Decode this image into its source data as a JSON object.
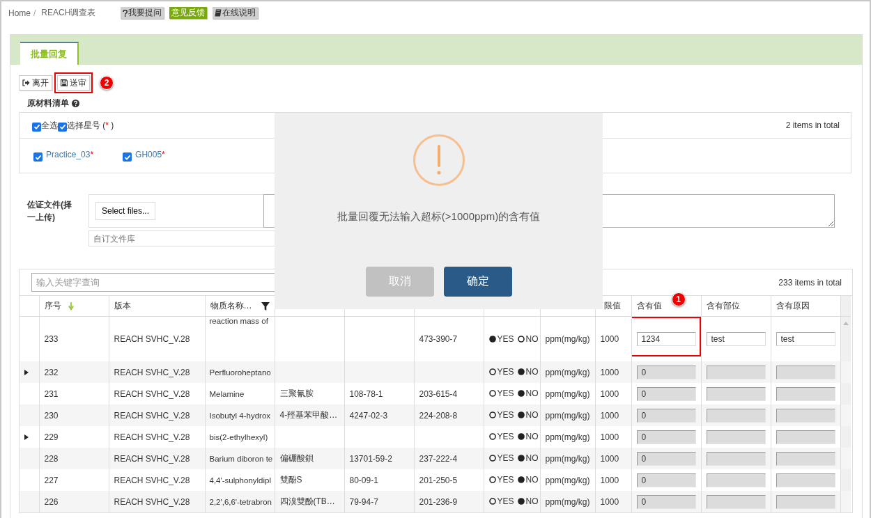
{
  "breadcrumb": [
    "Home",
    "REACH调查表"
  ],
  "breadcrumb_separator": "/",
  "header_buttons": [
    {
      "kind": "ask",
      "label": "我要提问"
    },
    {
      "kind": "feedback",
      "label": "意见反馈"
    },
    {
      "kind": "manual",
      "label": "在线说明"
    }
  ],
  "tabs": [
    {
      "label": "批量回复",
      "selected": true
    }
  ],
  "toolbar": [
    {
      "kind": "exit",
      "label": "离开",
      "highlighted": false
    },
    {
      "kind": "submit",
      "label": "送审",
      "highlighted": true,
      "badge": "2"
    }
  ],
  "materials_section": {
    "title": "原材料清单",
    "options": [
      {
        "label": "全选",
        "checked": true
      },
      {
        "label": "选择星号 (",
        "mark": "*",
        "suffix": " )",
        "checked": true
      }
    ],
    "total": "2 items in total",
    "items": [
      {
        "label": "Practice_03",
        "mark": "*",
        "checked": true
      },
      {
        "label": "GH005",
        "mark": "*",
        "checked": true
      }
    ]
  },
  "evidence": {
    "label": "佐证文件(择一上传)",
    "select_button": "Select files...",
    "library_placeholder": "自订文件库"
  },
  "grid": {
    "search_placeholder": "输入关键字查询",
    "total": "233 items in total",
    "columns": [
      {
        "label": "序号",
        "sorted_descending": true
      },
      {
        "label": "版本"
      },
      {
        "label": "物质名称…",
        "filter": true
      },
      {},
      {},
      {},
      {},
      {},
      {
        "label": "限值"
      },
      {
        "label": "含有值",
        "badge": "1"
      },
      {
        "label": "含有部位"
      },
      {
        "label": "含有原因"
      }
    ],
    "rows": [
      {
        "expandable": false,
        "seq": "233",
        "version": "REACH SVHC_V.28",
        "name": "reaction mass of",
        "ec": "473-390-7",
        "options": [
          {
            "label": "YES",
            "selected": true
          },
          {
            "label": "NO",
            "selected": false
          }
        ],
        "unit": "ppm(mg/kg)",
        "limit": "1000",
        "value": "1234",
        "part": "test",
        "reason": "test",
        "disabled": false,
        "highlighted": true
      },
      {
        "expandable": true,
        "seq": "232",
        "version": "REACH SVHC_V.28",
        "name": "Perfluoroheptano",
        "options": [
          {
            "label": "YES",
            "selected": false
          },
          {
            "label": "NO",
            "selected": true
          }
        ],
        "unit": "ppm(mg/kg)",
        "limit": "1000",
        "value": "0",
        "disabled": true,
        "highlighted": false
      },
      {
        "expandable": false,
        "seq": "231",
        "version": "REACH SVHC_V.28",
        "name": "Melamine",
        "name_cn": "三聚氰胺",
        "cas": "108-78-1",
        "ec": "203-615-4",
        "options": [
          {
            "label": "YES",
            "selected": false
          },
          {
            "label": "NO",
            "selected": true
          }
        ],
        "unit": "ppm(mg/kg)",
        "limit": "1000",
        "value": "0",
        "disabled": true,
        "highlighted": false
      },
      {
        "expandable": false,
        "seq": "230",
        "version": "REACH SVHC_V.28",
        "name": "Isobutyl 4-hydrox",
        "name_cn": "4-羥基苯甲酸…",
        "cas": "4247-02-3",
        "ec": "224-208-8",
        "options": [
          {
            "label": "YES",
            "selected": false
          },
          {
            "label": "NO",
            "selected": true
          }
        ],
        "unit": "ppm(mg/kg)",
        "limit": "1000",
        "value": "0",
        "disabled": true,
        "highlighted": false
      },
      {
        "expandable": true,
        "seq": "229",
        "version": "REACH SVHC_V.28",
        "name": "bis(2-ethylhexyl)",
        "options": [
          {
            "label": "YES",
            "selected": false
          },
          {
            "label": "NO",
            "selected": true
          }
        ],
        "unit": "ppm(mg/kg)",
        "limit": "1000",
        "value": "0",
        "disabled": true,
        "highlighted": false
      },
      {
        "expandable": false,
        "seq": "228",
        "version": "REACH SVHC_V.28",
        "name": "Barium diboron te",
        "name_cn": "偏硼酸鋇",
        "cas": "13701-59-2",
        "ec": "237-222-4",
        "options": [
          {
            "label": "YES",
            "selected": false
          },
          {
            "label": "NO",
            "selected": true
          }
        ],
        "unit": "ppm(mg/kg)",
        "limit": "1000",
        "value": "0",
        "disabled": true,
        "highlighted": false
      },
      {
        "expandable": false,
        "seq": "227",
        "version": "REACH SVHC_V.28",
        "name": "4,4'-sulphonyldipl",
        "name_cn": "雙酚S",
        "cas": "80-09-1",
        "ec": "201-250-5",
        "options": [
          {
            "label": "YES",
            "selected": false
          },
          {
            "label": "NO",
            "selected": true
          }
        ],
        "unit": "ppm(mg/kg)",
        "limit": "1000",
        "value": "0",
        "disabled": true,
        "highlighted": false
      },
      {
        "expandable": false,
        "seq": "226",
        "version": "REACH SVHC_V.28",
        "name": "2,2',6,6'-tetrabron",
        "name_cn": "四溴雙酚(TB…",
        "cas": "79-94-7",
        "ec": "201-236-9",
        "options": [
          {
            "label": "YES",
            "selected": false
          },
          {
            "label": "NO",
            "selected": true
          }
        ],
        "unit": "ppm(mg/kg)",
        "limit": "1000",
        "value": "0",
        "disabled": true,
        "highlighted": false
      }
    ]
  },
  "dialog": {
    "message": "批量回覆无法输入超标(>1000ppm)的含有值",
    "buttons": [
      {
        "kind": "cancel",
        "label": "取消"
      },
      {
        "kind": "confirm",
        "label": "确定"
      }
    ]
  }
}
